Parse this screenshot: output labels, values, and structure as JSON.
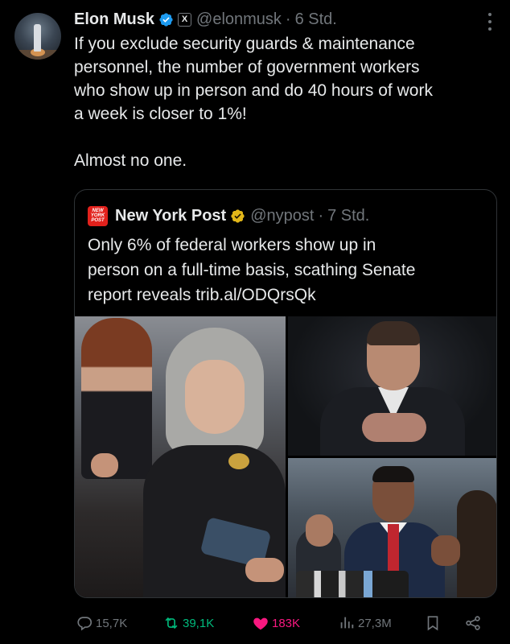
{
  "tweet": {
    "author_name": "Elon Musk",
    "handle": "@elonmusk",
    "separator": "·",
    "time": "6 Std.",
    "affiliate_badge": "X",
    "text_lines": [
      "If you exclude security guards & maintenance",
      "personnel, the number of government workers",
      "who show up in person and do 40 hours of work",
      "a week is closer to 1%!"
    ],
    "text_tail": "Almost no one."
  },
  "quote": {
    "logo_text": "NEW YORK POST",
    "author_name": "New York Post",
    "handle": "@nypost",
    "separator": "·",
    "time": "7 Std.",
    "text_lines": [
      "Only 6% of federal workers show up in",
      "person on a full-time basis, scathing Senate",
      "report reveals trib.al/ODQrsQk"
    ]
  },
  "actions": {
    "replies": "15,7K",
    "reposts": "39,1K",
    "likes": "183K",
    "views": "27,3M"
  },
  "colors": {
    "background": "#000000",
    "text": "#e7e9ea",
    "muted": "#71767b",
    "verified_blue": "#1d9bf0",
    "verified_gold": "#e2b719",
    "repost_green": "#00ba7c",
    "like_pink": "#f91880",
    "nypost_red": "#e2211c"
  },
  "icons": {
    "verified": "verified-badge-icon",
    "affiliate": "x-logo-icon",
    "more": "more-dots-icon",
    "reply": "reply-icon",
    "repost": "repost-icon",
    "like": "heart-icon",
    "views": "views-icon",
    "bookmark": "bookmark-icon",
    "share": "share-icon"
  }
}
